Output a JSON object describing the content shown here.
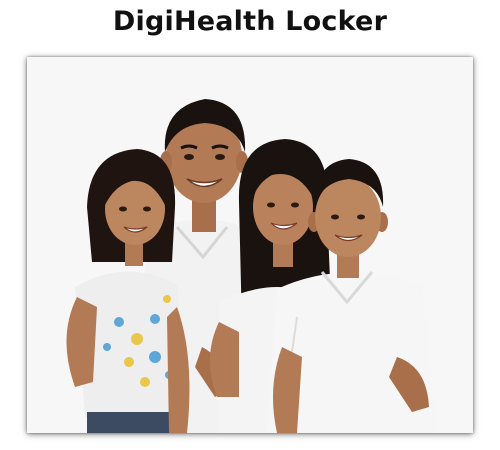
{
  "title": "DigiHealth Locker",
  "photo": {
    "subject": "family-photo",
    "colors": {
      "background": "#f7f7f7",
      "skin": "#b27a55",
      "skin_shadow": "#8f5a3a",
      "hair": "#1a120e",
      "shirt": "#f4f4f4",
      "shirt_shadow": "#d9d9d9",
      "jeans": "#3c4a62",
      "flower_blue": "#5ea7d8",
      "flower_yellow": "#e9c74a"
    }
  }
}
